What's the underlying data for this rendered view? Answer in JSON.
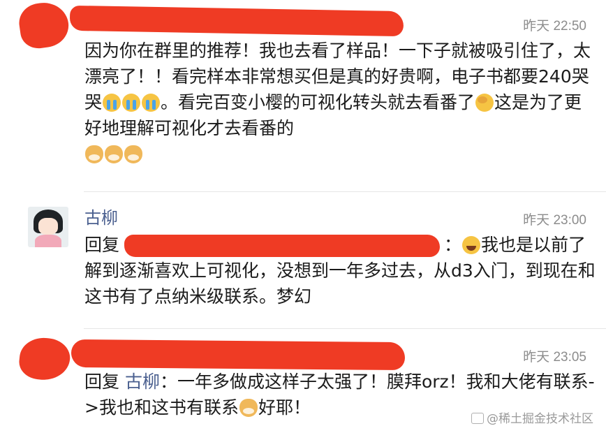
{
  "comments": [
    {
      "time": "昨天 22:50",
      "text": {
        "p1": "因为你在群里的推荐！我也去看了样品！一下子就被吸引住了，太漂亮了！！看完样本非常想买但是真的好贵啊，电子书都要240哭哭",
        "p2": "。看完百变小樱的可视化转头就去看番了",
        "p3": "这是为了更好地理解可视化才去看番的"
      }
    },
    {
      "name": "古柳",
      "time": "昨天 23:00",
      "reply_prefix": "回复",
      "reply_colon": "：",
      "text": {
        "p1": "我也是以前了解到逐渐喜欢上可视化，没想到一年多过去，从d3入门，到现在和这书有了点纳米级联系。梦幻"
      }
    },
    {
      "time": "昨天 23:05",
      "reply_prefix": "回复 ",
      "reply_to": "古柳",
      "text": {
        "p1": "：一年多做成这样子太强了！膜拜orz！我和大佬有联系->我也和这书有联系",
        "p2": "好耶！"
      }
    }
  ],
  "watermark": "@稀土掘金技术社区",
  "colors": {
    "redaction": "#ef3b24",
    "name": "#4a5f8f",
    "time": "#8c8c8c"
  },
  "icons": [
    "cry-emoji",
    "facepalm-emoji",
    "doge-emoji",
    "laugh-emoji"
  ]
}
